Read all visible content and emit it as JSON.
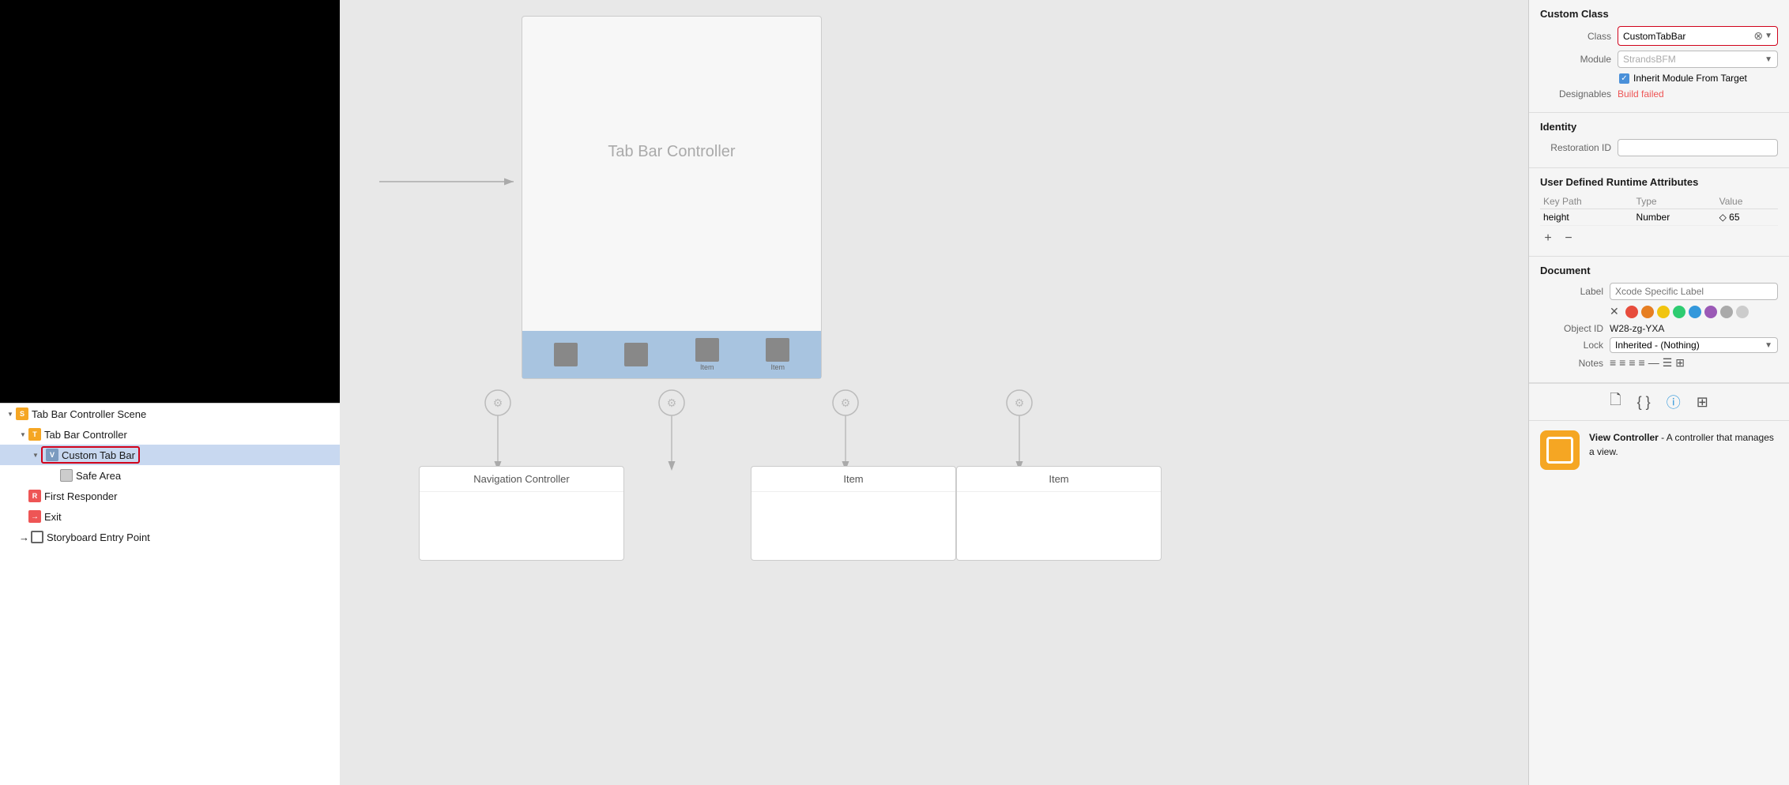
{
  "leftPanel": {
    "outlineItems": [
      {
        "id": "scene",
        "label": "Tab Bar Controller Scene",
        "indent": 0,
        "iconType": "scene",
        "hasTriangle": true,
        "open": true
      },
      {
        "id": "tabbar-controller",
        "label": "Tab Bar Controller",
        "indent": 1,
        "iconType": "tabbar",
        "hasTriangle": true,
        "open": true
      },
      {
        "id": "custom-tab-bar",
        "label": "Custom Tab Bar",
        "indent": 2,
        "iconType": "view",
        "hasTriangle": true,
        "open": false,
        "selected": true
      },
      {
        "id": "safe-area",
        "label": "Safe Area",
        "indent": 3,
        "iconType": "safearea",
        "hasTriangle": false
      },
      {
        "id": "first-responder",
        "label": "First Responder",
        "indent": 1,
        "iconType": "responder",
        "hasTriangle": false
      },
      {
        "id": "exit",
        "label": "Exit",
        "indent": 1,
        "iconType": "exit",
        "hasTriangle": false
      },
      {
        "id": "entry-point",
        "label": "Storyboard Entry Point",
        "indent": 1,
        "iconType": "entry",
        "hasTriangle": false
      }
    ]
  },
  "canvas": {
    "tabBarControllerTitle": "Tab Bar Controller",
    "navigationControllerLabel": "Navigation Controller",
    "itemLabel": "Item",
    "tabIcons": [
      "Item",
      "Item"
    ],
    "arrowLabel": ""
  },
  "rightPanel": {
    "customClass": {
      "sectionTitle": "Custom Class",
      "classLabel": "Class",
      "classValue": "CustomTabBar",
      "moduleLabel": "Module",
      "moduleValue": "StrandsBFM",
      "checkboxLabel": "Inherit Module From Target",
      "designablesLabel": "Designables",
      "designablesValue": "Build failed"
    },
    "identity": {
      "sectionTitle": "Identity",
      "restorationIdLabel": "Restoration ID",
      "restorationIdValue": ""
    },
    "runtimeAttributes": {
      "sectionTitle": "User Defined Runtime Attributes",
      "columns": [
        "Key Path",
        "Type",
        "Value"
      ],
      "rows": [
        {
          "keyPath": "height",
          "type": "Number",
          "value": "◇ 65"
        }
      ]
    },
    "document": {
      "sectionTitle": "Document",
      "labelLabel": "Label",
      "labelPlaceholder": "Xcode Specific Label",
      "colors": [
        "#e74c3c",
        "#e67e22",
        "#f1c40f",
        "#2ecc71",
        "#3498db",
        "#9b59b6",
        "#aaa",
        "#ccc"
      ],
      "objectIdLabel": "Object ID",
      "objectIdValue": "W28-zg-YXA",
      "lockLabel": "Lock",
      "lockValue": "Inherited - (Nothing)",
      "notesLabel": "Notes"
    },
    "bottomDesc": {
      "title": "View Controller",
      "description": "- A controller that manages a view."
    }
  }
}
